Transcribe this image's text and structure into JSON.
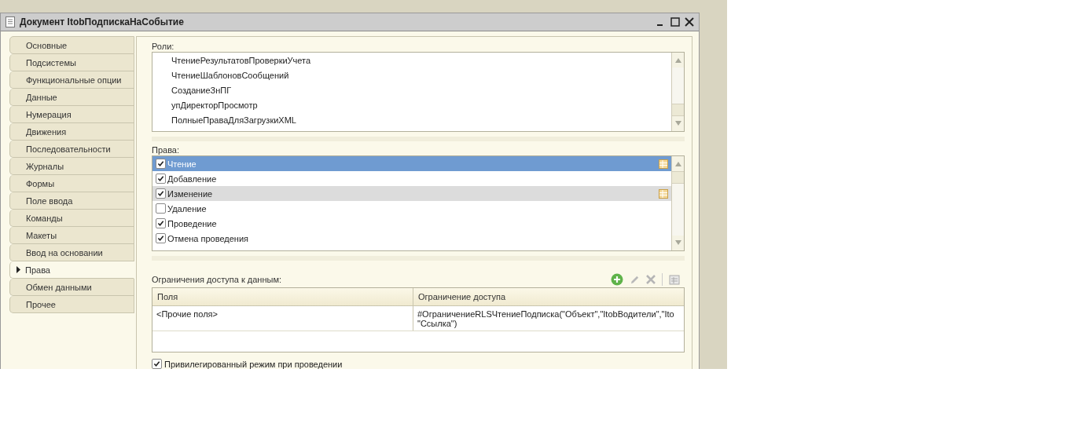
{
  "window": {
    "title": "Документ ItobПодпискаНаСобытие"
  },
  "tabs": [
    {
      "label": "Основные",
      "selected": false
    },
    {
      "label": "Подсистемы",
      "selected": false
    },
    {
      "label": "Функциональные опции",
      "selected": false
    },
    {
      "label": "Данные",
      "selected": false
    },
    {
      "label": "Нумерация",
      "selected": false
    },
    {
      "label": "Движения",
      "selected": false
    },
    {
      "label": "Последовательности",
      "selected": false
    },
    {
      "label": "Журналы",
      "selected": false
    },
    {
      "label": "Формы",
      "selected": false
    },
    {
      "label": "Поле ввода",
      "selected": false
    },
    {
      "label": "Команды",
      "selected": false
    },
    {
      "label": "Макеты",
      "selected": false
    },
    {
      "label": "Ввод на основании",
      "selected": false
    },
    {
      "label": "Права",
      "selected": true
    },
    {
      "label": "Обмен данными",
      "selected": false
    },
    {
      "label": "Прочее",
      "selected": false
    }
  ],
  "roles": {
    "label": "Роли:",
    "items": [
      "ЧтениеРезультатовПроверкиУчета",
      "ЧтениеШаблоновСообщений",
      "СозданиеЗнПГ",
      "упДиректорПросмотр",
      "ПолныеПраваДляЗагрузкиXML"
    ]
  },
  "rights": {
    "label": "Права:",
    "items": [
      {
        "label": "Чтение",
        "checked": true,
        "selected": true,
        "highlighted": false,
        "restricted": true
      },
      {
        "label": "Добавление",
        "checked": true,
        "selected": false,
        "highlighted": false,
        "restricted": false
      },
      {
        "label": "Изменение",
        "checked": true,
        "selected": false,
        "highlighted": true,
        "restricted": true
      },
      {
        "label": "Удаление",
        "checked": false,
        "selected": false,
        "highlighted": false,
        "restricted": false
      },
      {
        "label": "Проведение",
        "checked": true,
        "selected": false,
        "highlighted": false,
        "restricted": false
      },
      {
        "label": "Отмена проведения",
        "checked": true,
        "selected": false,
        "highlighted": false,
        "restricted": false
      }
    ]
  },
  "restrictions": {
    "label": "Ограничения доступа к данным:",
    "columns": [
      "Поля",
      "Ограничение доступа"
    ],
    "rows": [
      {
        "fields": "<Прочие поля>",
        "restriction": [
          "#ОграничениеRLSЧтениеПодписка(\"Объект\",\"ItobВодители\",\"Ito",
          " \"Ссылка\")"
        ]
      }
    ]
  },
  "privileged": {
    "label": "Привилегированный режим при проведении",
    "checked": true
  }
}
